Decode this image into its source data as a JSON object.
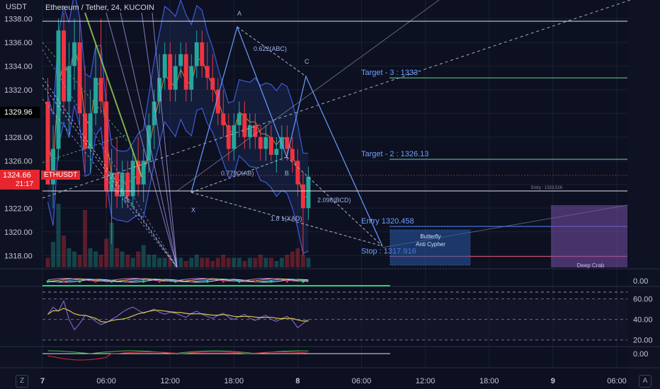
{
  "header": {
    "unit": "USDT",
    "title": "Ethereum / Tether, 24, KUCOIN"
  },
  "price_badge": {
    "price": "1324.66",
    "time": "21:17",
    "symbol": "ETHUSDT"
  },
  "crosshair_price": "1329.96",
  "colors": {
    "background": "#0c1020",
    "bull": "#26a69a",
    "bear": "#ef3340",
    "band": "#3d5bd8",
    "orange": "#d9832f",
    "yellow": "#d8c84a",
    "purple": "#8a6fe0",
    "target_line": "#6fcf97",
    "stop_line": "#e05a7a",
    "entry_line": "#4f86ff"
  },
  "toolbar": {
    "z": "Z",
    "a": "A"
  },
  "chart_data": [
    {
      "type": "candlestick",
      "ylim": [
        1317,
        1338.5
      ],
      "ytick_labels": [
        "1318.00",
        "1320.00",
        "1322.00",
        "1324.00",
        "1326.00",
        "1328.00",
        "1330.00",
        "1332.00",
        "1334.00",
        "1336.00",
        "1338.00"
      ],
      "yticks": [
        1318,
        1320,
        1322,
        1324,
        1326,
        1328,
        1330,
        1332,
        1334,
        1336,
        1338
      ],
      "x_tick_labels": [
        "7",
        "06:00",
        "12:00",
        "18:00",
        "8",
        "06:00",
        "12:00",
        "18:00",
        "9",
        "06:00"
      ],
      "x_ticks": [
        0,
        6,
        12,
        18,
        24,
        30,
        36,
        42,
        48,
        54
      ],
      "xlim": [
        0,
        55
      ],
      "candles": [
        [
          0.5,
          1331,
          1333,
          1327,
          1324
        ],
        [
          1,
          1324,
          1329,
          1322,
          1327
        ],
        [
          1.5,
          1327,
          1338,
          1326,
          1337
        ],
        [
          2,
          1337,
          1338.5,
          1330,
          1331
        ],
        [
          2.5,
          1331,
          1336,
          1328,
          1334
        ],
        [
          3,
          1334,
          1338,
          1332,
          1336
        ],
        [
          3.5,
          1336,
          1338,
          1329,
          1330
        ],
        [
          4,
          1330,
          1334,
          1325,
          1327
        ],
        [
          4.5,
          1327,
          1332,
          1325,
          1330
        ],
        [
          5,
          1330,
          1336,
          1329,
          1333
        ],
        [
          5.5,
          1333,
          1338,
          1330,
          1331
        ],
        [
          6,
          1331,
          1333,
          1322,
          1323.5
        ],
        [
          6.5,
          1323.5,
          1327,
          1319,
          1325
        ],
        [
          7,
          1325,
          1328,
          1322,
          1323
        ],
        [
          7.5,
          1323,
          1326,
          1322,
          1325
        ],
        [
          8,
          1325,
          1326,
          1322,
          1323
        ],
        [
          8.5,
          1323,
          1327,
          1322,
          1326
        ],
        [
          9,
          1326,
          1328,
          1323,
          1324
        ],
        [
          9.5,
          1324,
          1327,
          1322.5,
          1326
        ],
        [
          10,
          1326,
          1330,
          1325,
          1329
        ],
        [
          10.5,
          1329,
          1332,
          1327,
          1331
        ],
        [
          11,
          1331,
          1335,
          1330,
          1333
        ],
        [
          11.5,
          1333,
          1336,
          1332,
          1335
        ],
        [
          12,
          1335,
          1336,
          1331,
          1332
        ],
        [
          12.5,
          1332,
          1335,
          1331,
          1334
        ],
        [
          13,
          1334,
          1336,
          1333,
          1335
        ],
        [
          13.5,
          1335,
          1336,
          1331,
          1332
        ],
        [
          14,
          1332,
          1335,
          1331,
          1334
        ],
        [
          14.5,
          1334,
          1337,
          1333,
          1336
        ],
        [
          15,
          1336,
          1337,
          1333,
          1334
        ],
        [
          15.5,
          1334,
          1336,
          1332,
          1333
        ],
        [
          16,
          1333,
          1335,
          1331,
          1332
        ],
        [
          16.5,
          1332,
          1333,
          1329,
          1330
        ],
        [
          17,
          1330,
          1332,
          1328,
          1329
        ],
        [
          17.5,
          1329,
          1330,
          1326,
          1327
        ],
        [
          18,
          1327,
          1330,
          1326,
          1329
        ],
        [
          18.5,
          1329,
          1331,
          1328,
          1330
        ],
        [
          19,
          1330,
          1331,
          1327,
          1328
        ],
        [
          19.5,
          1328,
          1330,
          1327,
          1329
        ],
        [
          20,
          1329,
          1330,
          1327,
          1328
        ],
        [
          20.5,
          1328,
          1329,
          1326,
          1327
        ],
        [
          21,
          1327,
          1329,
          1326,
          1328
        ],
        [
          21.5,
          1328,
          1329,
          1326,
          1326.5
        ],
        [
          22,
          1326.5,
          1328,
          1325,
          1327
        ],
        [
          22.5,
          1327,
          1329,
          1326,
          1328
        ],
        [
          23,
          1328,
          1329,
          1326,
          1327
        ],
        [
          23.5,
          1327,
          1328,
          1325,
          1326
        ],
        [
          24,
          1326,
          1327,
          1323,
          1324
        ],
        [
          24.5,
          1324,
          1325,
          1318,
          1322
        ],
        [
          25,
          1322,
          1325.5,
          1321,
          1324.66
        ]
      ],
      "volume": [
        3,
        8,
        20,
        10,
        6,
        5,
        4,
        18,
        6,
        5,
        4,
        9,
        14,
        6,
        5,
        4,
        3,
        5,
        7,
        4,
        4,
        3,
        3,
        4,
        3,
        3,
        2,
        3,
        4,
        3,
        3,
        2,
        3,
        4,
        3,
        3,
        3,
        2,
        3,
        3,
        4,
        3,
        3,
        2,
        3,
        4,
        5,
        6,
        4,
        3
      ]
    },
    {
      "type": "annotations",
      "pattern_labels": [
        "A",
        "B",
        "C",
        "D",
        "X",
        "0.622(ABC)",
        "0.779(XAB)",
        "2.096(BCD)",
        "1.8 1(XAD)"
      ],
      "targets": [
        {
          "label": "Target - 3 : 1333",
          "price": 1333
        },
        {
          "label": "Target - 2 : 1326.13",
          "price": 1326.13
        },
        {
          "label": "Entry  1320.458",
          "price": 1320.458
        },
        {
          "label": "Stop : 1317.916",
          "price": 1317.916
        }
      ],
      "entry_note": "Entry : 1323.516",
      "boxes": [
        {
          "label": "Butterfly",
          "sub": "Anti Cypher"
        },
        {
          "label": "Deep Crab"
        }
      ]
    },
    {
      "type": "line",
      "name": "",
      "ytick_labels": [
        "0.00"
      ],
      "ylim": [
        -1,
        1
      ]
    },
    {
      "type": "line",
      "ytick_labels": [
        "60.00",
        "40.00",
        "20.00"
      ],
      "yticks": [
        60,
        40,
        20
      ],
      "ylim": [
        15,
        70
      ],
      "values": [
        45,
        52,
        48,
        58,
        40,
        30,
        36,
        44,
        42,
        38,
        35,
        37,
        40,
        43,
        47,
        50,
        52,
        49,
        46,
        48,
        50,
        47,
        45,
        47,
        46,
        44,
        42,
        46,
        48,
        45,
        43,
        41,
        44,
        46,
        42,
        40,
        43,
        45,
        41,
        39,
        42,
        44,
        40,
        38,
        41,
        43,
        39,
        32,
        36,
        40
      ]
    },
    {
      "type": "line",
      "ytick_labels": [
        "0.00"
      ],
      "ylim": [
        -1,
        1
      ]
    }
  ]
}
